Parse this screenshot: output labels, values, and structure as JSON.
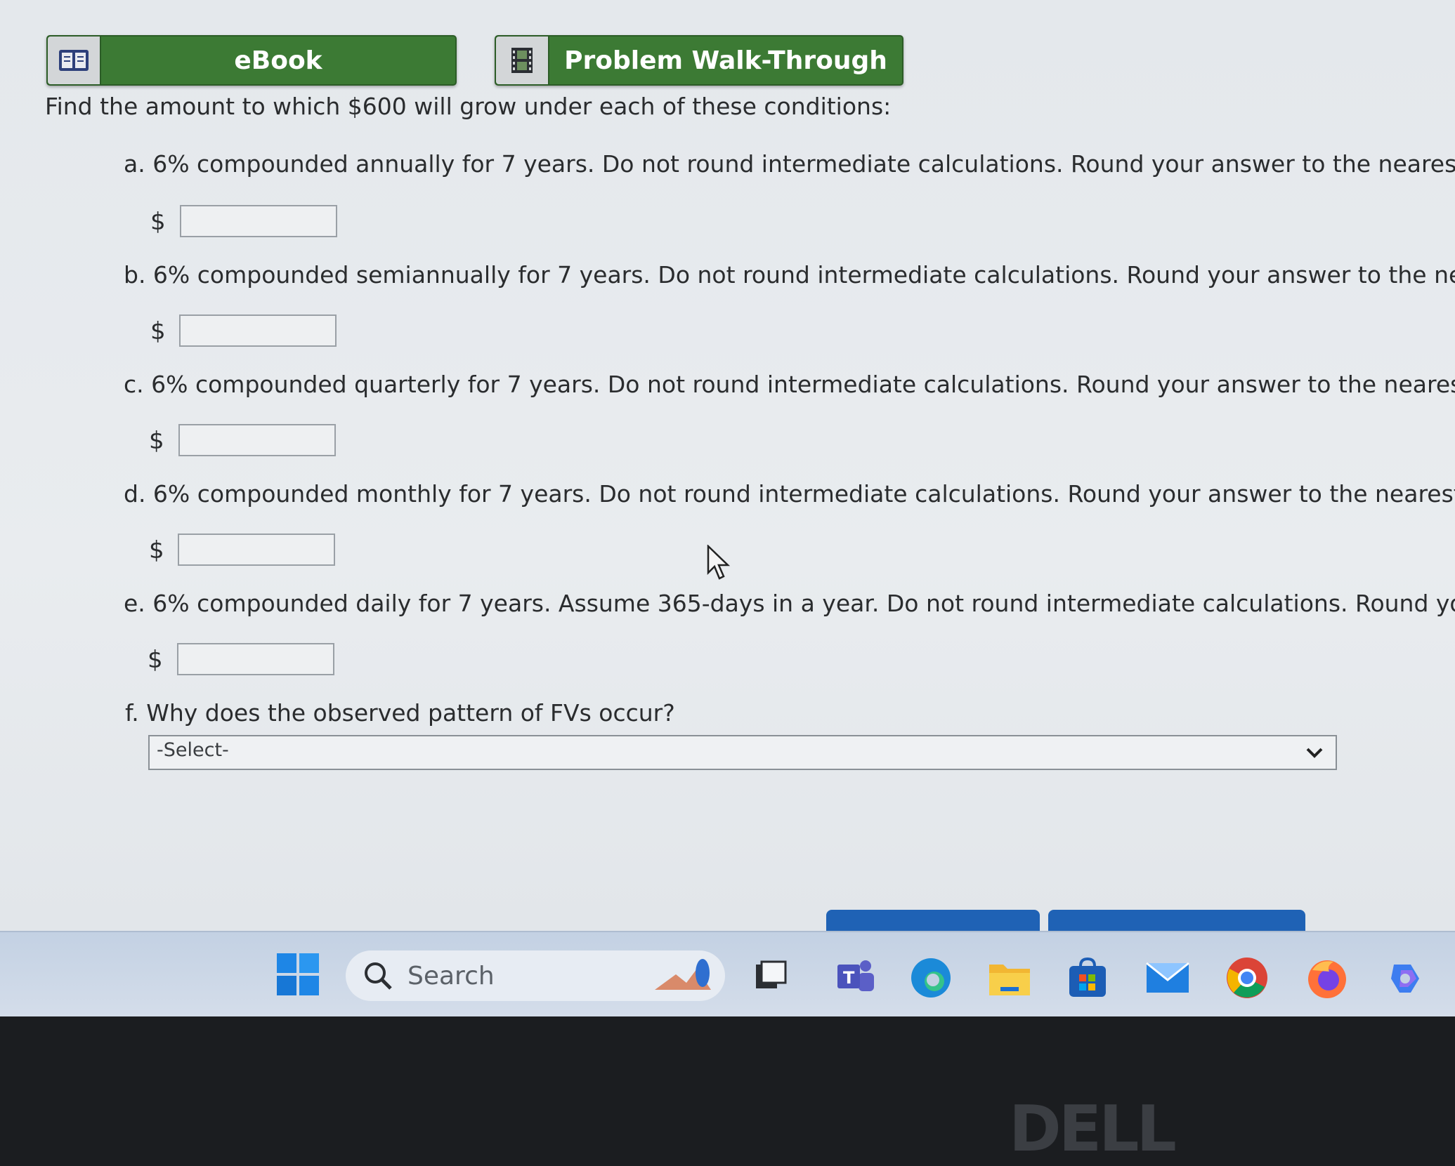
{
  "toolbar": {
    "ebook_label": "eBook",
    "walkthrough_label": "Problem Walk-Through"
  },
  "prompt": "Find the amount to which $600 will grow under each of these conditions:",
  "questions": [
    {
      "text": "a. 6% compounded annually for 7 years. Do not round intermediate calculations. Round your answer to the nearest cent.",
      "currency": "$",
      "value": ""
    },
    {
      "text": "b. 6% compounded semiannually for 7 years. Do not round intermediate calculations. Round your answer to the nearest ce",
      "currency": "$",
      "value": ""
    },
    {
      "text": "c. 6% compounded quarterly for 7 years. Do not round intermediate calculations. Round your answer to the nearest cent.",
      "currency": "$",
      "value": ""
    },
    {
      "text": "d. 6% compounded monthly for 7 years. Do not round intermediate calculations. Round your answer to the nearest cent.",
      "currency": "$",
      "value": ""
    },
    {
      "text": "e. 6% compounded daily for 7 years. Assume 365-days in a year. Do not round intermediate calculations. Round your answ",
      "currency": "$",
      "value": ""
    }
  ],
  "question_f": {
    "text": "f. Why does the observed pattern of FVs occur?",
    "selected": "-Select-"
  },
  "taskbar": {
    "search_label": "Search",
    "icons": [
      "windows-start-icon",
      "search-icon",
      "widgets-icon",
      "task-view-icon",
      "teams-icon",
      "edge-icon",
      "file-explorer-icon",
      "microsoft-store-icon",
      "mail-icon",
      "chrome-icon",
      "firefox-icon",
      "copilot-icon"
    ]
  },
  "bezel": {
    "brand": "DELL"
  },
  "colors": {
    "button_green": "#3c7a34",
    "taskbar": "#c8d5e6",
    "page_bg": "#e6e9ec",
    "action_blue": "#1f62b5"
  }
}
